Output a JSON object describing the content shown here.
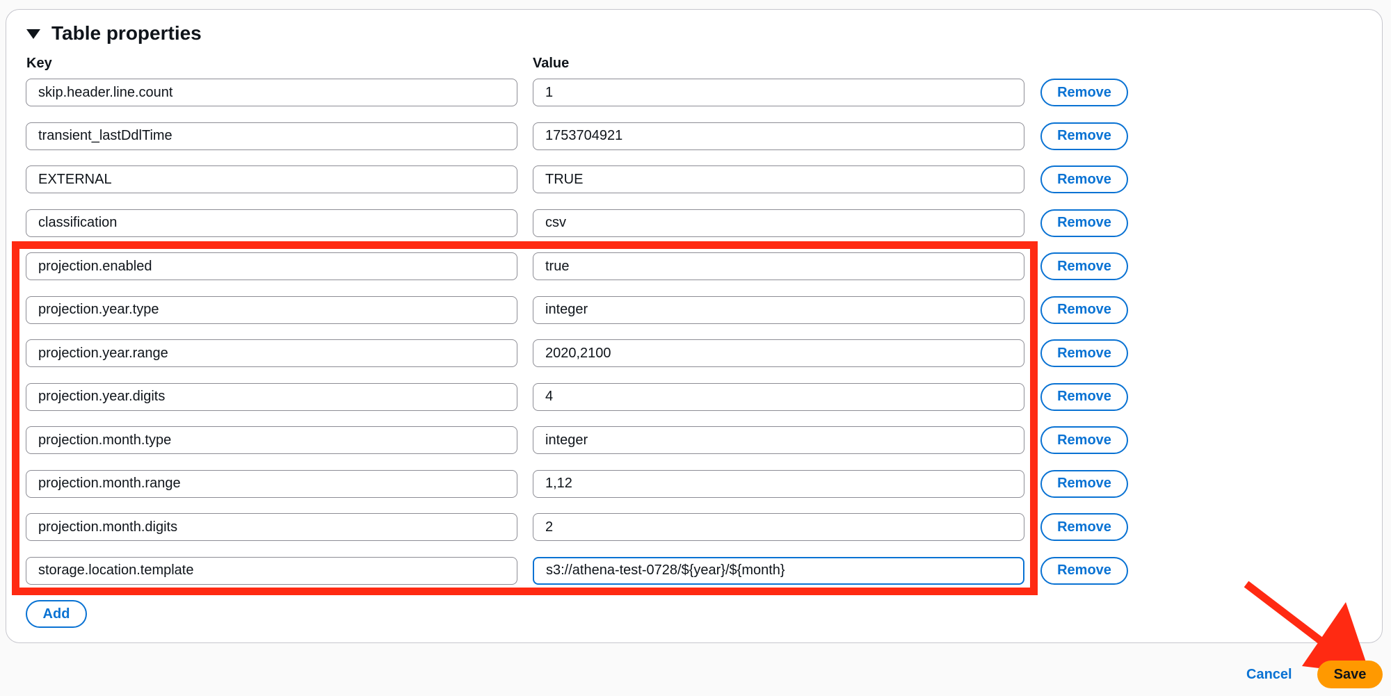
{
  "section": {
    "title": "Table properties",
    "key_label": "Key",
    "value_label": "Value"
  },
  "properties": [
    {
      "key": "skip.header.line.count",
      "value": "1",
      "remove_label": "Remove"
    },
    {
      "key": "transient_lastDdlTime",
      "value": "1753704921",
      "remove_label": "Remove"
    },
    {
      "key": "EXTERNAL",
      "value": "TRUE",
      "remove_label": "Remove"
    },
    {
      "key": "classification",
      "value": "csv",
      "remove_label": "Remove"
    },
    {
      "key": "projection.enabled",
      "value": "true",
      "remove_label": "Remove"
    },
    {
      "key": "projection.year.type",
      "value": "integer",
      "remove_label": "Remove"
    },
    {
      "key": "projection.year.range",
      "value": "2020,2100",
      "remove_label": "Remove"
    },
    {
      "key": "projection.year.digits",
      "value": "4",
      "remove_label": "Remove"
    },
    {
      "key": "projection.month.type",
      "value": "integer",
      "remove_label": "Remove"
    },
    {
      "key": "projection.month.range",
      "value": "1,12",
      "remove_label": "Remove"
    },
    {
      "key": "projection.month.digits",
      "value": "2",
      "remove_label": "Remove"
    },
    {
      "key": "storage.location.template",
      "value": "s3://athena-test-0728/${year}/${month}",
      "remove_label": "Remove"
    }
  ],
  "add_label": "Add",
  "footer": {
    "cancel_label": "Cancel",
    "save_label": "Save"
  },
  "colors": {
    "accent": "#0972d3",
    "primary_button": "#ff9900",
    "annotation": "#ff2a12"
  },
  "icons": {
    "section_toggle": "caret-down-icon"
  }
}
